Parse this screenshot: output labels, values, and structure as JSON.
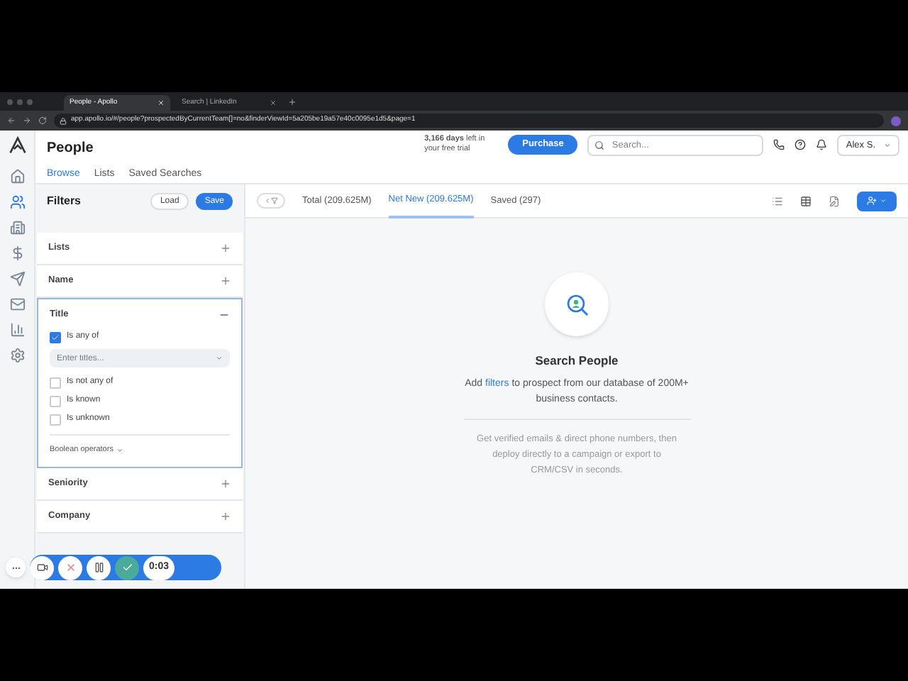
{
  "browser": {
    "tabs": [
      {
        "title": "People - Apollo",
        "selected": true
      },
      {
        "title": "Search | LinkedIn",
        "selected": false
      }
    ],
    "url": "app.apollo.io/#/people?prospectedByCurrentTeam[]=no&finderViewId=5a205be19a57e40c0095e1d5&page=1"
  },
  "nav": [
    {
      "kind": "home",
      "selected": false
    },
    {
      "kind": "people",
      "selected": true
    },
    {
      "kind": "company",
      "selected": false
    },
    {
      "kind": "dollar",
      "selected": false
    },
    {
      "kind": "send",
      "selected": false
    },
    {
      "kind": "mail",
      "selected": false
    },
    {
      "kind": "chart",
      "selected": false
    },
    {
      "kind": "settings",
      "selected": false
    }
  ],
  "header": {
    "title": "People",
    "tabs": [
      {
        "label": "Browse",
        "selected": true
      },
      {
        "label": "Lists",
        "selected": false
      },
      {
        "label": "Saved Searches",
        "selected": false
      }
    ],
    "trial": "**3,166 days** left in your free trial",
    "purchase": "Purchase",
    "search_placeholder": "Search...",
    "user": "Alex S."
  },
  "filters": {
    "title": "Filters",
    "load": "Load",
    "save": "Save",
    "sections": [
      {
        "label": "Lists",
        "expanded": false
      },
      {
        "label": "Name",
        "expanded": false
      },
      {
        "label": "Title",
        "expanded": true,
        "options": [
          {
            "label": "Is any of",
            "checked": true
          },
          {
            "label": "Is not any of",
            "checked": false
          },
          {
            "label": "Is known",
            "checked": false
          },
          {
            "label": "Is unknown",
            "checked": false
          }
        ],
        "input_placeholder": "Enter titles...",
        "boolean": "Boolean operators"
      },
      {
        "label": "Seniority",
        "expanded": false
      },
      {
        "label": "Company",
        "expanded": false
      }
    ]
  },
  "results": {
    "tabs": [
      {
        "label": "Total (209.625M)",
        "selected": false
      },
      {
        "label": "Net New (209.625M)",
        "selected": true
      },
      {
        "label": "Saved (297)",
        "selected": false
      }
    ]
  },
  "empty": {
    "title": "Search People",
    "before": "Add",
    "link": "filters",
    "after": "to prospect from our database of 200M+ business contacts.",
    "note": "Get verified emails & direct phone numbers, then deploy directly to a campaign or export to CRM/CSV in seconds."
  },
  "recorder": {
    "timer": "0:03"
  }
}
